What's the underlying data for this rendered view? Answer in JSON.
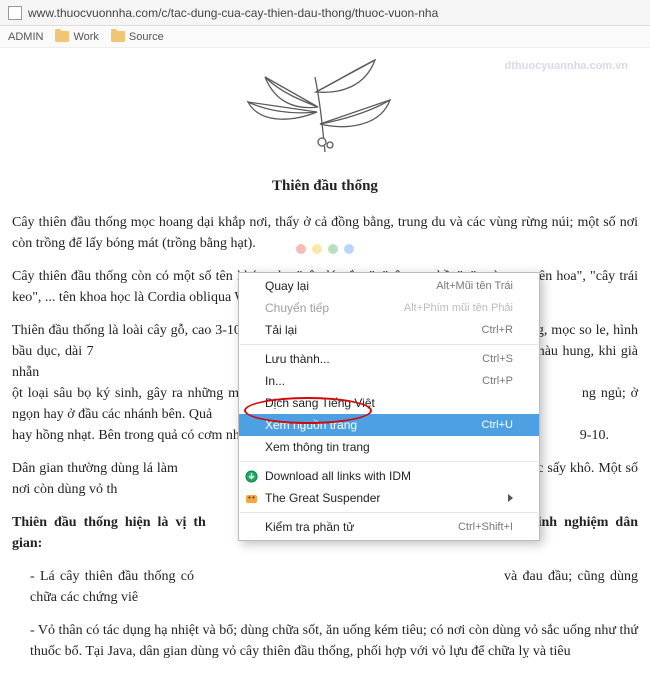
{
  "url": "www.thuocvuonnha.com/c/tac-dung-cua-cay-thien-dau-thong/thuoc-vuon-nha",
  "bookmarks": {
    "admin": "ADMIN",
    "work": "Work",
    "source": "Source"
  },
  "watermark": "dthuocyuannha.com.vn",
  "article": {
    "title": "Thiên đầu thống",
    "p1": "Cây thiên đầu thống mọc hoang dại khắp nơi, thấy ở cả đồng bằng, trung du và các vùng rừng núi; một số nơi còn trồng để lấy bóng mát (trồng bằng hạt).",
    "p2": "Cây thiên đầu thống còn có một số tên khác, như \"cây lá trắng\", \"cây ong bầu\", \"trường xuyên hoa\", \"cây trái keo\", ... tên khoa học là Cordia obliqua Willd. (Corlia dichotoma Forst).",
    "p3_a": "Thiên đầu thống là loài cây gỗ, cao 3-10m, cành phân nhánh màu trắng nhạt. Lá hơi dai, cứng, mọc so le, hình bầu dục, dài 7",
    "p3_b": "ơn. Lá non có lông tơ màu hung, khi già nhẵn",
    "p3_c": "ột loại sâu bọ ký sinh, gây ra những mụn nh",
    "p3_d": "ng ngủ; ở ngọn hay ở đầu các nhánh bên. Quả",
    "p3_e": "hay hồng nhạt. Bên trong quả có cơm nhầy và",
    "p3_f": "9-10.",
    "p4_a": "Dân gian thường dùng lá làm",
    "p4_b": "phơi hoặc sấy khô. Một số nơi còn dùng vỏ th",
    "h2_a": "Thiên đầu thống hiện là vị th",
    "h2_b": "o kinh nghiệm dân gian:",
    "li1_a": "- Lá cây thiên đầu thống có",
    "li1_b": "và đau đầu; cũng dùng chữa các chứng viê",
    "li2": "- Vỏ thân có tác dụng hạ nhiệt và bổ; dùng chữa sốt, ăn uống kém tiêu; có nơi còn dùng vỏ sắc uống như thứ thuốc bổ. Tại Java, dân gian dùng vỏ cây thiên đầu thống, phối hợp với vỏ lựu để chữa lỵ và tiêu"
  },
  "ctx": {
    "back": {
      "label": "Quay lại",
      "shortcut": "Alt+Mũi tên Trái"
    },
    "forward": {
      "label": "Chuyển tiếp",
      "shortcut": "Alt+Phím mũi tên Phải"
    },
    "reload": {
      "label": "Tải lại",
      "shortcut": "Ctrl+R"
    },
    "saveas": {
      "label": "Lưu thành...",
      "shortcut": "Ctrl+S"
    },
    "print": {
      "label": "In...",
      "shortcut": "Ctrl+P"
    },
    "translate": {
      "label": "Dịch sang Tiếng Việt",
      "shortcut": ""
    },
    "viewsource": {
      "label": "Xem nguồn trang",
      "shortcut": "Ctrl+U"
    },
    "pageinfo": {
      "label": "Xem thông tin trang",
      "shortcut": ""
    },
    "idm": {
      "label": "Download all links with IDM",
      "shortcut": ""
    },
    "suspender": {
      "label": "The Great Suspender",
      "shortcut": ""
    },
    "inspect": {
      "label": "Kiểm tra phần tử",
      "shortcut": "Ctrl+Shift+I"
    }
  }
}
